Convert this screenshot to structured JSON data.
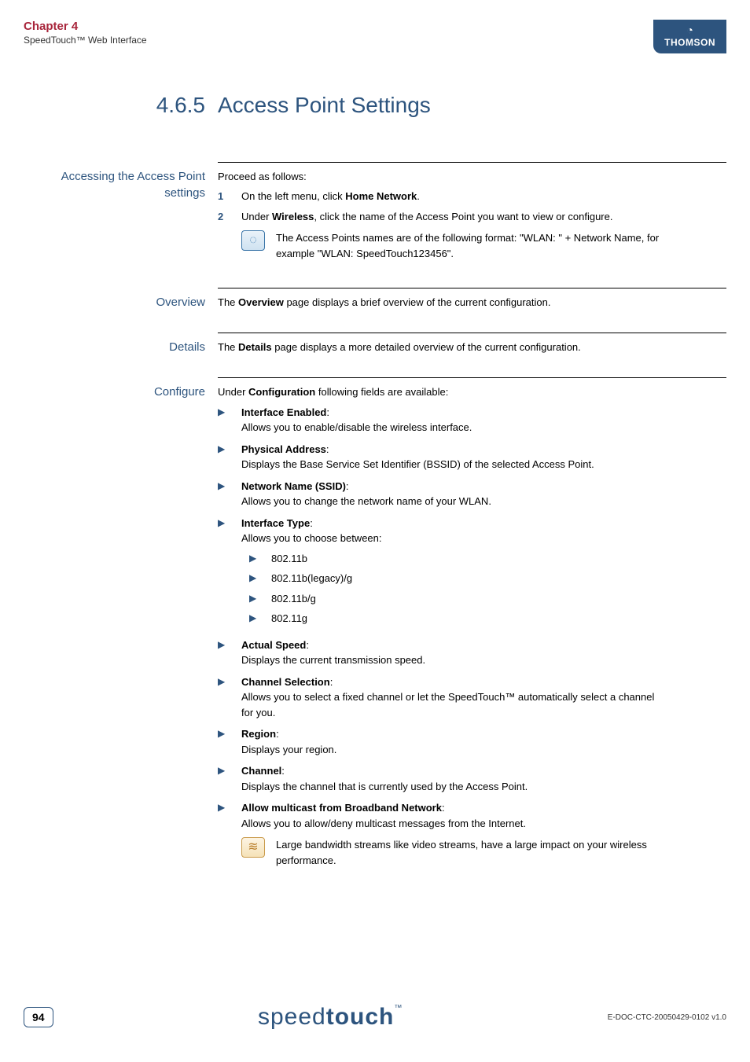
{
  "header": {
    "chapter": "Chapter 4",
    "subtitle": "SpeedTouch™ Web Interface",
    "thomson": "THOMSON"
  },
  "title": {
    "number": "4.6.5",
    "text": "Access Point Settings"
  },
  "accessing": {
    "label": "Accessing the Access Point settings",
    "intro": "Proceed as follows:",
    "step1_pre": "On the left menu, click ",
    "step1_bold": "Home Network",
    "step1_post": ".",
    "step2_pre": "Under ",
    "step2_bold": "Wireless",
    "step2_post": ", click the name of the Access Point you want to view or configure.",
    "callout": "The Access Points names are of the following format: \"WLAN: \" + Network Name, for example \"WLAN: SpeedTouch123456\"."
  },
  "overview": {
    "label": "Overview",
    "pre": "The ",
    "bold": "Overview",
    "post": " page displays a brief overview of the current configuration."
  },
  "details": {
    "label": "Details",
    "pre": "The ",
    "bold": "Details",
    "post": " page displays a more detailed overview of the current configuration."
  },
  "configure": {
    "label": "Configure",
    "intro_pre": "Under ",
    "intro_bold": "Configuration",
    "intro_post": " following fields are available:",
    "items": {
      "iface_enabled_t": "Interface Enabled",
      "iface_enabled_d": "Allows you to enable/disable the wireless interface.",
      "phys_t": "Physical Address",
      "phys_d": "Displays the Base Service Set Identifier (BSSID) of the selected Access Point.",
      "ssid_t": "Network Name (SSID)",
      "ssid_d": "Allows you to change the network name of your WLAN.",
      "itype_t": "Interface Type",
      "itype_d": "Allows you to choose between:",
      "itype_1": "802.11b",
      "itype_2": "802.11b(legacy)/g",
      "itype_3": "802.11b/g",
      "itype_4": "802.11g",
      "speed_t": "Actual Speed",
      "speed_d": "Displays the current transmission speed.",
      "chsel_t": "Channel Selection",
      "chsel_d": "Allows you to select a fixed channel or let the SpeedTouch™ automatically select a channel for you.",
      "region_t": "Region",
      "region_d": "Displays your region.",
      "channel_t": "Channel",
      "channel_d": "Displays the channel that is currently used by the Access Point.",
      "multicast_t": "Allow multicast from Broadband Network",
      "multicast_d": "Allows you to allow/deny multicast messages from the Internet.",
      "multicast_warn": "Large bandwidth streams like video streams, have a large impact on your wireless performance."
    }
  },
  "footer": {
    "page": "94",
    "brand_light": "speed",
    "brand_bold": "touch",
    "brand_tm": "™",
    "docid": "E-DOC-CTC-20050429-0102 v1.0"
  }
}
